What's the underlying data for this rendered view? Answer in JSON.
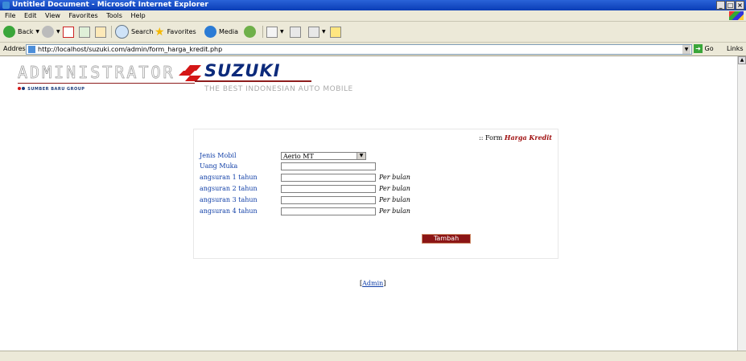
{
  "window": {
    "title": "Untitled Document - Microsoft Internet Explorer",
    "buttons": [
      "_",
      "□",
      "×"
    ]
  },
  "menubar": {
    "items": [
      "File",
      "Edit",
      "View",
      "Favorites",
      "Tools",
      "Help"
    ]
  },
  "toolbar": {
    "back": "Back",
    "search": "Search",
    "favorites": "Favorites",
    "media": "Media"
  },
  "addressbar": {
    "label": "Address",
    "url": "http://localhost/suzuki.com/admin/form_harga_kredit.php",
    "go": "Go",
    "links": "Links"
  },
  "header": {
    "admin_logo": "ADMINISTRATOR",
    "brand": "SUZUKI",
    "tagline": "THE BEST INDONESIAN AUTO MOBILE",
    "group": "SUMBER BARU GROUP"
  },
  "form": {
    "header_prefix": ":: Form",
    "header_title": "Harga Kredit",
    "fields": [
      {
        "label": "Jenis Mobil",
        "value": "Aerio MT"
      },
      {
        "label": "Uang Muka",
        "value": ""
      },
      {
        "label": "angsuran 1 tahun",
        "value": "",
        "suffix": "Per bulan"
      },
      {
        "label": "angsuran 2 tahun",
        "value": "",
        "suffix": "Per bulan"
      },
      {
        "label": "angsuran 3 tahun",
        "value": "",
        "suffix": "Per bulan"
      },
      {
        "label": "angsuran 4 tahun",
        "value": "",
        "suffix": "Per bulan"
      }
    ],
    "submit": "Tambah"
  },
  "footer": {
    "link_open": "[",
    "link_text": "Admin",
    "link_close": "]"
  }
}
